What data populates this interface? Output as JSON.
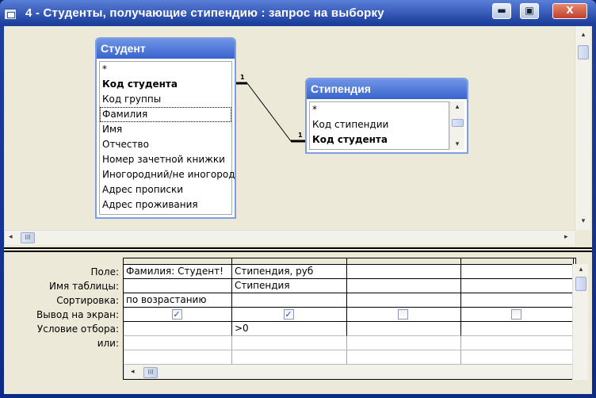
{
  "window": {
    "title": "4 - Студенты, получающие стипендию : запрос на выборку",
    "min": "▬",
    "max": "▣",
    "close": "X"
  },
  "tables": [
    {
      "name": "Студент",
      "fields": [
        {
          "t": "*"
        },
        {
          "t": "Код студента",
          "bold": true
        },
        {
          "t": "Код группы"
        },
        {
          "t": "Фамилия",
          "sel": true
        },
        {
          "t": "Имя"
        },
        {
          "t": "Отчество"
        },
        {
          "t": "Номер зачетной книжки"
        },
        {
          "t": "Иногородний/не иногородний"
        },
        {
          "t": "Адрес прописки"
        },
        {
          "t": "Адрес проживания"
        }
      ]
    },
    {
      "name": "Стипендия",
      "fields": [
        {
          "t": "*"
        },
        {
          "t": "Код стипендии"
        },
        {
          "t": "Код студента",
          "bold": true
        }
      ]
    }
  ],
  "relation": {
    "left": "1",
    "right": "1"
  },
  "grid": {
    "labels": [
      "Поле:",
      "Имя таблицы:",
      "Сортировка:",
      "Вывод на экран:",
      "Условие отбора:",
      "или:"
    ],
    "columns": [
      {
        "field": "Фамилия: Студент!",
        "table": "",
        "sort": "по возрастанию",
        "show": true,
        "criteria": "",
        "or": ""
      },
      {
        "field": "Стипендия, руб",
        "table": "Стипендия",
        "sort": "",
        "show": true,
        "criteria": ">0",
        "or": ""
      },
      {
        "field": "",
        "table": "",
        "sort": "",
        "show": false,
        "criteria": "",
        "or": ""
      },
      {
        "field": "",
        "table": "",
        "sort": "",
        "show": false,
        "criteria": "",
        "or": ""
      }
    ]
  },
  "scroll": {
    "thumb": "III",
    "left": "◂",
    "right": "▸",
    "up": "▴",
    "down": "▾",
    "check": "✓"
  }
}
